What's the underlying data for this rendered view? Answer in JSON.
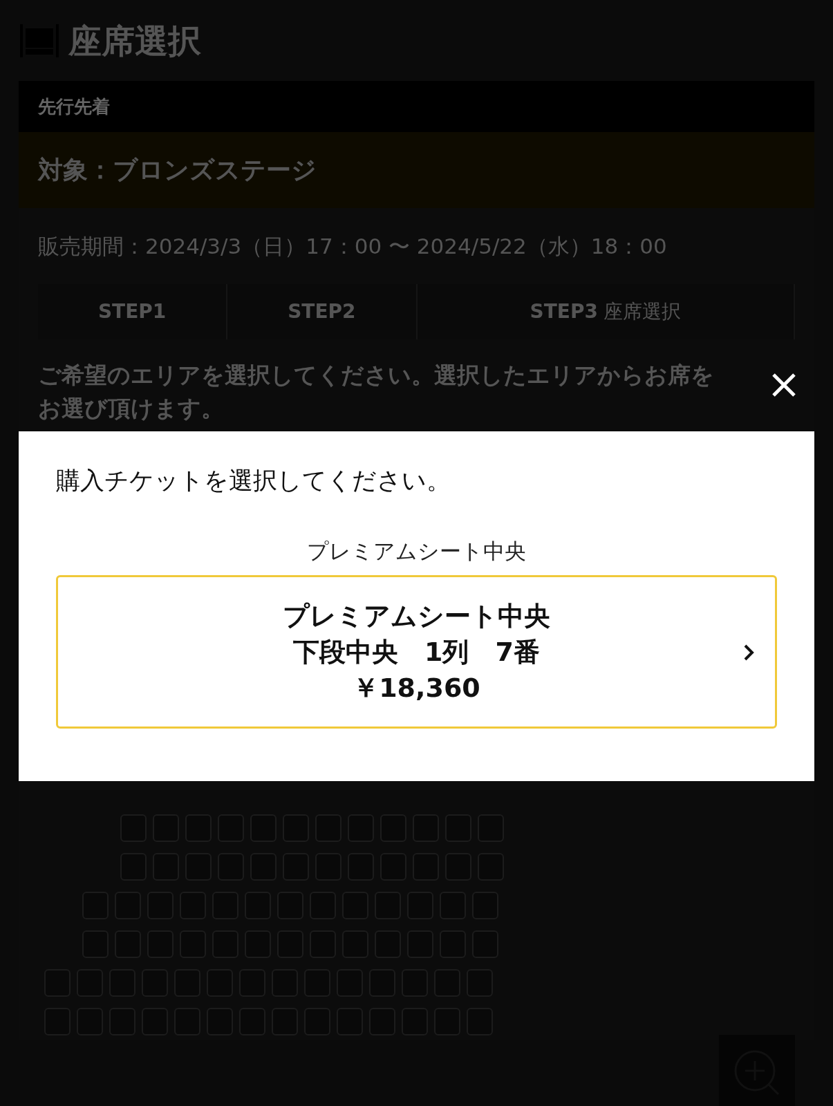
{
  "header": {
    "title": "座席選択"
  },
  "sale_type": "先行先着",
  "target": "対象：ブロンズステージ",
  "sale_period": "販売期間：2024/3/3（日）17：00 〜 2024/5/22（水）18：00",
  "steps": [
    {
      "label": "STEP1"
    },
    {
      "label": "STEP2"
    },
    {
      "label": "STEP3",
      "sub": "座席選択"
    }
  ],
  "instruction": [
    "ご希望のエリアを選択してください。選択したエリアからお席を",
    "お選び頂けます。"
  ],
  "modal": {
    "prompt": "購入チケットを選択してください。",
    "group_label": "プレミアムシート中央",
    "tickets": [
      {
        "name": "プレミアムシート中央",
        "seat": "下段中央　1列　7番",
        "price": "￥18,360"
      }
    ]
  }
}
